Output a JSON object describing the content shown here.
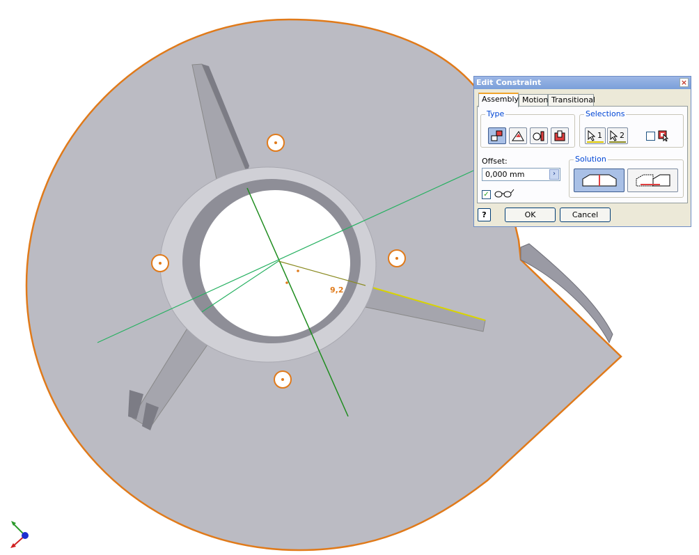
{
  "viewport": {
    "dimension_label": "9,2"
  },
  "dialog": {
    "title": "Edit Constraint",
    "tabs": [
      {
        "label": "Assembly",
        "active": true
      },
      {
        "label": "Motion",
        "active": false
      },
      {
        "label": "Transitional",
        "active": false
      }
    ],
    "type_group": {
      "label": "Type",
      "buttons": [
        {
          "icon": "mate-icon",
          "pressed": true
        },
        {
          "icon": "angle-icon",
          "pressed": false
        },
        {
          "icon": "tangent-icon",
          "pressed": false
        },
        {
          "icon": "insert-icon",
          "pressed": false
        }
      ]
    },
    "selections_group": {
      "label": "Selections",
      "select1_label": "1",
      "select2_label": "2",
      "predict_offset_checked": false
    },
    "offset": {
      "label": "Offset:",
      "value": "0,000 mm"
    },
    "show_preview_checked": true,
    "solution_group": {
      "label": "Solution",
      "options": [
        {
          "icon": "mate-solution-icon",
          "pressed": true
        },
        {
          "icon": "flush-solution-icon",
          "pressed": false
        }
      ]
    },
    "ok_label": "OK",
    "cancel_label": "Cancel",
    "help_label": "?"
  },
  "colors": {
    "part_face": "#bbbbc3",
    "part_edge": "#e07a1a",
    "axis_green": "#1e8c1e",
    "highlight_yellow": "#d9d400",
    "dialog_bg": "#ece9d8",
    "title_blue": "#7a9fd9"
  }
}
